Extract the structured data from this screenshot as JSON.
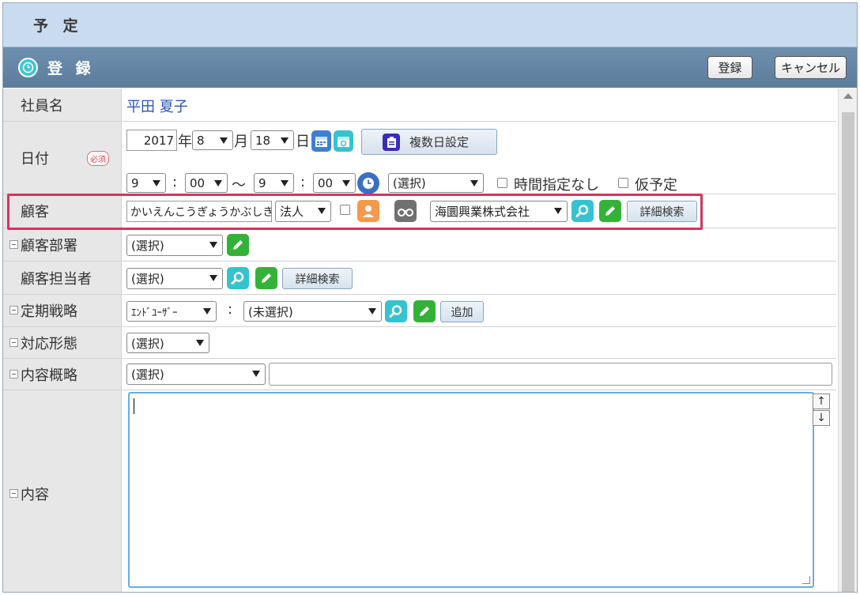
{
  "window": {
    "title": "予 定"
  },
  "section": {
    "title": "登 録",
    "register_label": "登録",
    "cancel_label": "キャンセル"
  },
  "employee": {
    "label": "社員名",
    "name": "平田 夏子"
  },
  "date": {
    "label": "日付",
    "required_badge": "必須",
    "year": "2017",
    "year_unit": "年",
    "month": "8",
    "month_unit": "月",
    "day": "18",
    "day_unit": "日",
    "multi_day_label": "複数日設定",
    "start_hour": "9",
    "start_minute": "00",
    "time_sep": ":",
    "range_sep": "～",
    "end_hour": "9",
    "end_minute": "00",
    "time_preset": "(選択)",
    "no_time_label": "時間指定なし",
    "tentative_label": "仮予定"
  },
  "customer": {
    "label": "顧客",
    "kana_value": "かいえんこうぎょうかぶしきがいしゃ",
    "type": "法人",
    "company": "海圜興業株式会社",
    "detail_search_label": "詳細検索"
  },
  "customer_dept": {
    "label": "顧客部署",
    "value": "(選択)"
  },
  "customer_contact": {
    "label": "顧客担当者",
    "value": "(選択)",
    "detail_search_label": "詳細検索"
  },
  "strategy": {
    "label": "定期戦略",
    "type_value": "ｴﾝﾄﾞﾕｰｻﾞｰ",
    "sep": ":",
    "value": "(未選択)",
    "add_label": "追加"
  },
  "response": {
    "label": "対応形態",
    "value": "(選択)"
  },
  "summary": {
    "label": "内容概略",
    "value": "(選択)",
    "text": ""
  },
  "details": {
    "label": "内容",
    "text": ""
  },
  "colors": {
    "highlight": "#d4345f",
    "header": "#c9dcef",
    "section": "#6585a5"
  },
  "icons": {
    "calendar": "calendar-icon",
    "calendar_alt": "calendar-alt-icon",
    "clipboard": "clipboard-icon",
    "clock": "clock-icon",
    "person": "person-icon",
    "binoculars": "binoculars-icon",
    "search": "search-icon",
    "edit": "pencil-icon"
  }
}
